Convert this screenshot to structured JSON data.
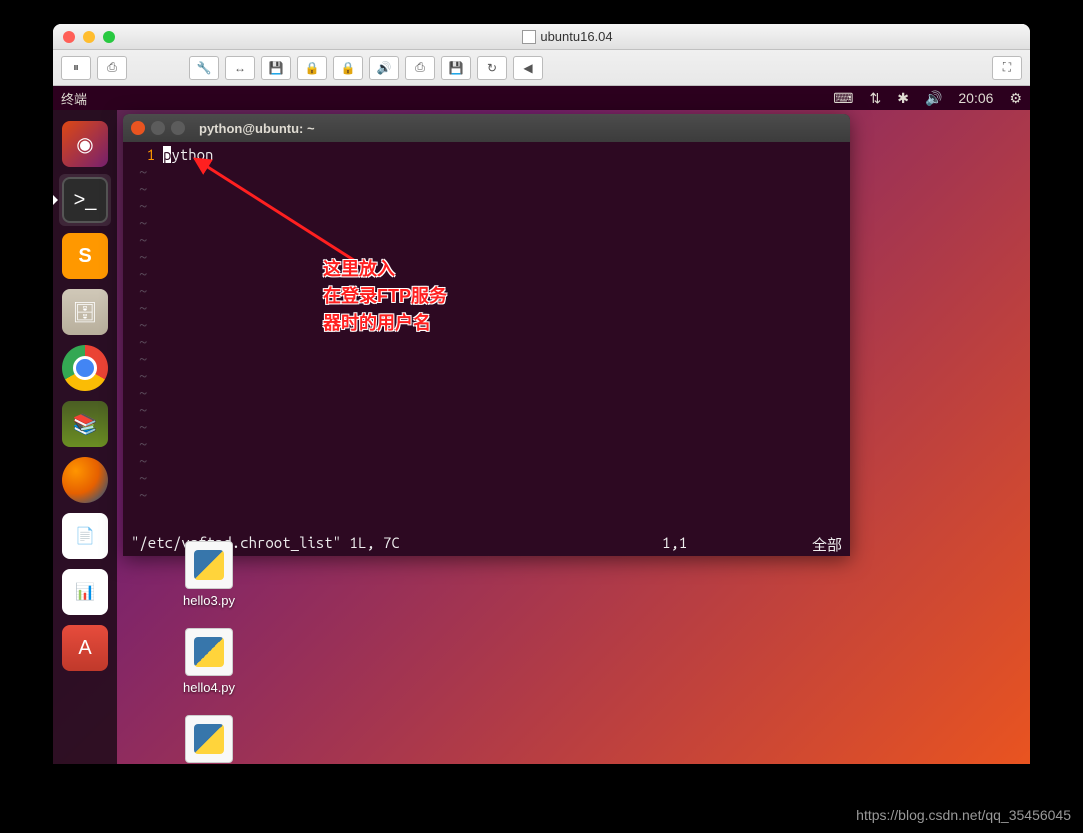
{
  "mac": {
    "title": "ubuntu16.04"
  },
  "top_panel": {
    "app_name": "终端",
    "time": "20:06"
  },
  "terminal": {
    "title": "python@ubuntu: ~",
    "line_num": "1",
    "content_first": "p",
    "content_rest": "ython",
    "status_file": "\"/etc/vsftpd.chroot_list\" 1L, 7C",
    "status_pos": "1,1",
    "status_right": "全部"
  },
  "annotation": {
    "line1": "这里放入",
    "line2": "在登录FTP服务",
    "line3": "器时的用户名"
  },
  "desktop": {
    "files": [
      {
        "name": "hello3.py"
      },
      {
        "name": "hello4.py"
      }
    ]
  },
  "launcher": {
    "items": [
      "ubuntu",
      "terminal",
      "sublime",
      "files",
      "chrome",
      "books",
      "firefox",
      "writer",
      "calc",
      "software"
    ]
  },
  "watermark": "https://blog.csdn.net/qq_35456045"
}
